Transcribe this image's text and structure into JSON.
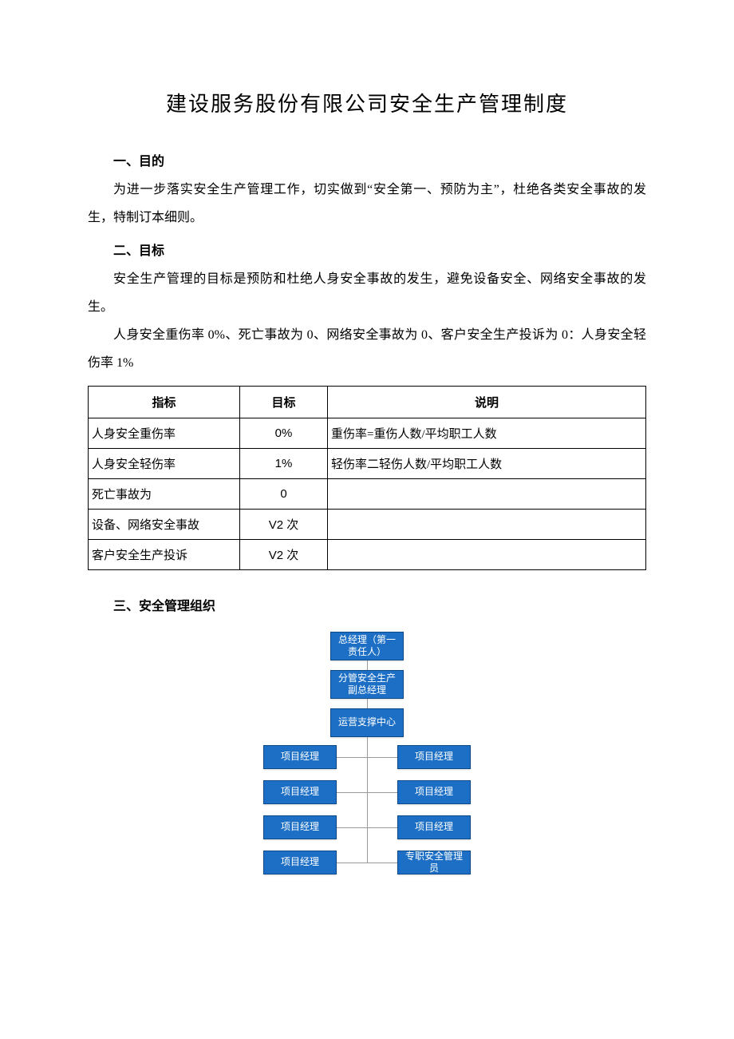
{
  "title": "建设服务股份有限公司安全生产管理制度",
  "sections": {
    "s1_heading": "一、目的",
    "s1_p1": "为进一步落实安全生产管理工作，切实做到“安全第一、预防为主”，杜绝各类安全事故的发生，特制订本细则。",
    "s2_heading": "二、目标",
    "s2_p1": "安全生产管理的目标是预防和杜绝人身安全事故的发生，避免设备安全、网络安全事故的发生。",
    "s2_p2": "人身安全重伤率 0%、死亡事故为 0、网络安全事故为 0、客户安全生产投诉为 0：人身安全轻伤率 1%",
    "s3_heading": "三、安全管理组织"
  },
  "table": {
    "headers": {
      "indicator": "指标",
      "target": "目标",
      "desc": "说明"
    },
    "rows": [
      {
        "indicator": "人身安全重伤率",
        "target": "0%",
        "desc": "重伤率=重伤人数/平均职工人数"
      },
      {
        "indicator": "人身安全轻伤率",
        "target": "1%",
        "desc": "轻伤率二轻伤人数/平均职工人数"
      },
      {
        "indicator": "死亡事故为",
        "target": "0",
        "desc": ""
      },
      {
        "indicator": "设备、网络安全事故",
        "target": "V2 次",
        "desc": ""
      },
      {
        "indicator": "客户安全生产投诉",
        "target": "V2 次",
        "desc": ""
      }
    ]
  },
  "orgchart": {
    "top1": "总经理（第一责任人）",
    "top2": "分管安全生产副总经理",
    "top3": "运营支撑中心",
    "rows": [
      {
        "left": "项目经理",
        "right": "项目经理"
      },
      {
        "left": "项目经理",
        "right": "项目经理"
      },
      {
        "left": "项目经理",
        "right": "项目经理"
      },
      {
        "left": "项目经理",
        "right": "专职安全管理员"
      }
    ]
  }
}
